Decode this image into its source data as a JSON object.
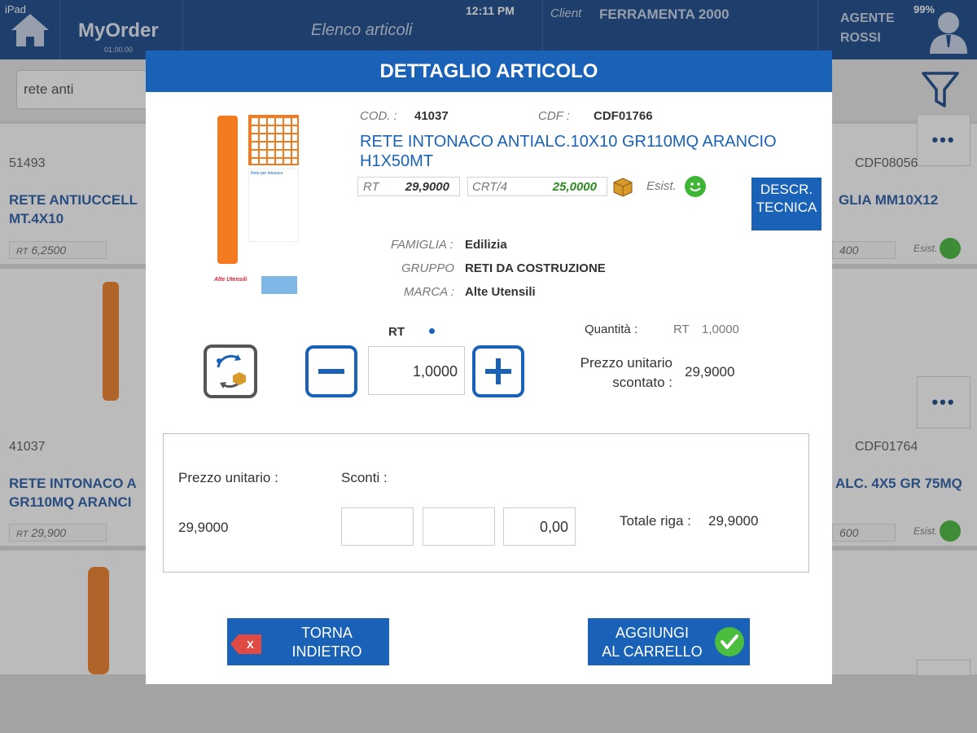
{
  "statusbar": {
    "device": "iPad",
    "time": "12:11 PM",
    "battery": "99%"
  },
  "header": {
    "app_name": "MyOrder",
    "app_version": "01.00.00",
    "screen_title": "Elenco articoli",
    "client_label": "Client",
    "client_name": "FERRAMENTA 2000",
    "agent_line1": "AGENTE",
    "agent_line2": "ROSSI"
  },
  "search": {
    "value": "rete anti"
  },
  "background_list": {
    "items": [
      {
        "code": "51493",
        "name_line1": "RETE ANTIUCCELL",
        "name_line2": "MT.4X10",
        "price": "6,2500",
        "price_unit": "RT",
        "right_cdf": "CDF08056",
        "right_name": "GLIA MM10X12",
        "right_price": "400",
        "right_status": "Esist."
      },
      {
        "code": "41037",
        "name_line1": "RETE INTONACO A",
        "name_line2": "GR110MQ ARANCI",
        "price": "29,900",
        "price_unit": "RT",
        "right_cdf": "CDF01764",
        "right_name": "ALC. 4X5 GR 75MQ",
        "right_price": "600",
        "right_status": "Esist."
      }
    ],
    "more_label": "•••"
  },
  "modal": {
    "title": "DETTAGLIO ARTICOLO",
    "cod_label": "COD. :",
    "cod_value": "41037",
    "cdf_label": "CDF :",
    "cdf_value": "CDF01766",
    "article_name": "RETE INTONACO ANTIALC.10X10 GR110MQ ARANCIO H1X50MT",
    "price_rt_label": "RT",
    "price_rt_value": "29,9000",
    "price_crt_label": "CRT/4",
    "price_crt_value": "25,0000",
    "stock_label": "Esist.",
    "descr_button": "DESCR. TECNICA",
    "famiglia_label": "FAMIGLIA :",
    "famiglia_value": "Edilizia",
    "gruppo_label": "GRUPPO",
    "gruppo_value": "RETI DA COSTRUZIONE",
    "marca_label": "MARCA :",
    "marca_value": "Alte Utensili",
    "unit_label": "RT",
    "quantity": "1,0000",
    "quantita_label": "Quantità :",
    "quantita_unit": "RT",
    "quantita_value": "1,0000",
    "prezzo_scontato_label_1": "Prezzo unitario",
    "prezzo_scontato_label_2": "scontato :",
    "prezzo_scontato_value": "29,9000",
    "prezzo_unitario_label": "Prezzo unitario :",
    "prezzo_unitario_value": "29,9000",
    "sconti_label": "Sconti :",
    "sconto_1": "",
    "sconto_2": "",
    "sconto_3": "0,00",
    "totale_label": "Totale riga :",
    "totale_value": "29,9000",
    "back_button_line1": "TORNA",
    "back_button_line2": "INDIETRO",
    "add_button_line1": "AGGIUNGI",
    "add_button_line2": "AL CARRELLO",
    "product_image_text": {
      "caption": "Rete per intonaco",
      "brand": "Alte Utensili"
    }
  },
  "colors": {
    "topbar": "#0e3f86",
    "accent_blue": "#1a62b7",
    "stock_green": "#3fb536",
    "crt_price_green": "#2a8a1f"
  }
}
